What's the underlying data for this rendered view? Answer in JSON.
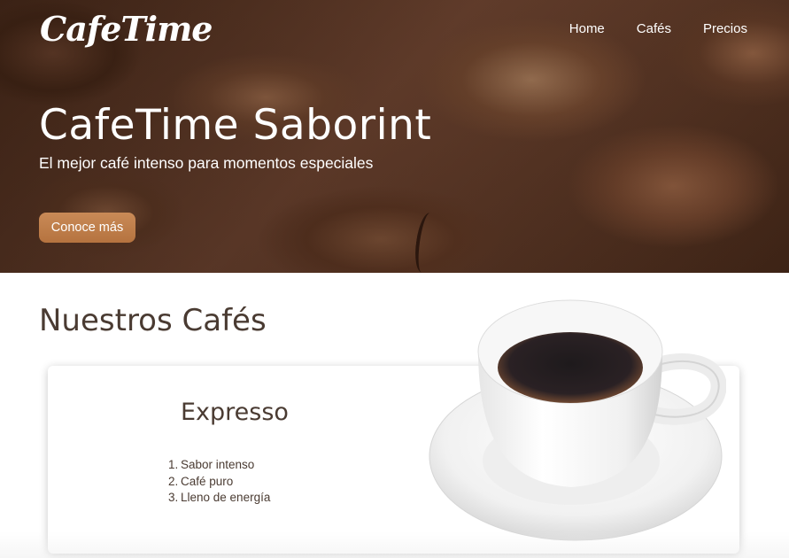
{
  "brand": {
    "logo_text": "CafeTime"
  },
  "nav": {
    "items": [
      {
        "label": "Home"
      },
      {
        "label": "Cafés"
      },
      {
        "label": "Precios"
      }
    ]
  },
  "hero": {
    "title": "CafeTime Saborint",
    "subtitle": "El mejor café intenso para momentos especiales",
    "cta_label": "Conoce más",
    "cta_color": "#c0804c"
  },
  "section": {
    "title": "Nuestros Cafés"
  },
  "product": {
    "name": "Expresso",
    "features": [
      {
        "num": "1.",
        "text": "Sabor intenso"
      },
      {
        "num": "2.",
        "text": "Café puro"
      },
      {
        "num": "3.",
        "text": "Lleno de energía"
      }
    ],
    "image_icon": "coffee-cup-icon"
  },
  "colors": {
    "text_primary": "#4a3b32",
    "accent": "#c0804c",
    "hero_overlay": "#3e2416"
  }
}
